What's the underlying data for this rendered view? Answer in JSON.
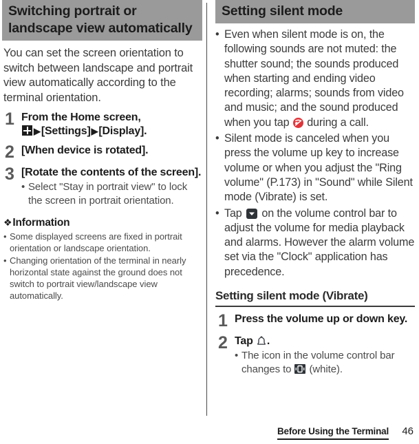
{
  "left_column": {
    "section_title": "Switching portrait or landscape view automatically",
    "intro_paragraph": "You can set the screen orientation to switch between landscape and portrait view automatically according to the terminal orientation.",
    "steps": [
      {
        "number": "1",
        "title_part1": "From the Home screen,",
        "title_icon": "app-grid-icon",
        "title_arrow1": "▶",
        "title_part2": "[Settings]",
        "title_arrow2": "▶",
        "title_part3": "[Display]."
      },
      {
        "number": "2",
        "title_part1": "[When device is rotated]."
      },
      {
        "number": "3",
        "title_part1": "[Rotate the contents of the screen].",
        "sub_bullets": [
          "Select \"Stay in portrait view\" to lock the screen in portrait orientation."
        ]
      }
    ],
    "information": {
      "diamond_glyph": "❖",
      "heading": "Information",
      "items": [
        "Some displayed screens are fixed in portrait orientation or landscape orientation.",
        "Changing orientation of the terminal in nearly horizontal state against the ground does not switch to portrait view/landscape view automatically."
      ]
    }
  },
  "right_column": {
    "section_title": "Setting silent mode",
    "bullets": [
      {
        "text_before": "Even when silent mode is on, the following sounds are not muted: the shutter sound; the sounds produced when starting and ending video recording; alarms; sounds from video and music; and the sound produced when you tap ",
        "icon": "call-mute-icon",
        "text_after": " during a call."
      },
      {
        "text_before": "Silent mode is canceled when you press the volume up key to increase volume or when you adjust the \"Ring volume\" (P.173) in \"Sound\" while Silent mode (Vibrate) is set.",
        "icon": null,
        "text_after": ""
      },
      {
        "text_before": "Tap ",
        "icon": "chevron-down-icon",
        "text_after": " on the volume control bar to adjust the volume for media playback and alarms. However the alarm volume set via the \"Clock\" application has precedence."
      }
    ],
    "subsection_title": "Setting silent mode (Vibrate)",
    "steps": [
      {
        "number": "1",
        "title_part1": "Press the volume up or down key."
      },
      {
        "number": "2",
        "title_before": "Tap ",
        "title_icon": "bell-icon",
        "title_after": ".",
        "sub_bullet_before": "The icon in the volume control bar changes to ",
        "sub_bullet_icon": "vibrate-icon",
        "sub_bullet_after": " (white)."
      }
    ]
  },
  "footer": {
    "title": "Before Using the Terminal",
    "page_number": "46"
  },
  "colors": {
    "header_bar_bg": "#9a9a9a",
    "body_text": "#3b3b3b",
    "heading_text": "#1c1c1c",
    "step_number": "#5a5a5a",
    "call_mute_red": "#e0343a",
    "icon_dark": "#2e3338"
  }
}
